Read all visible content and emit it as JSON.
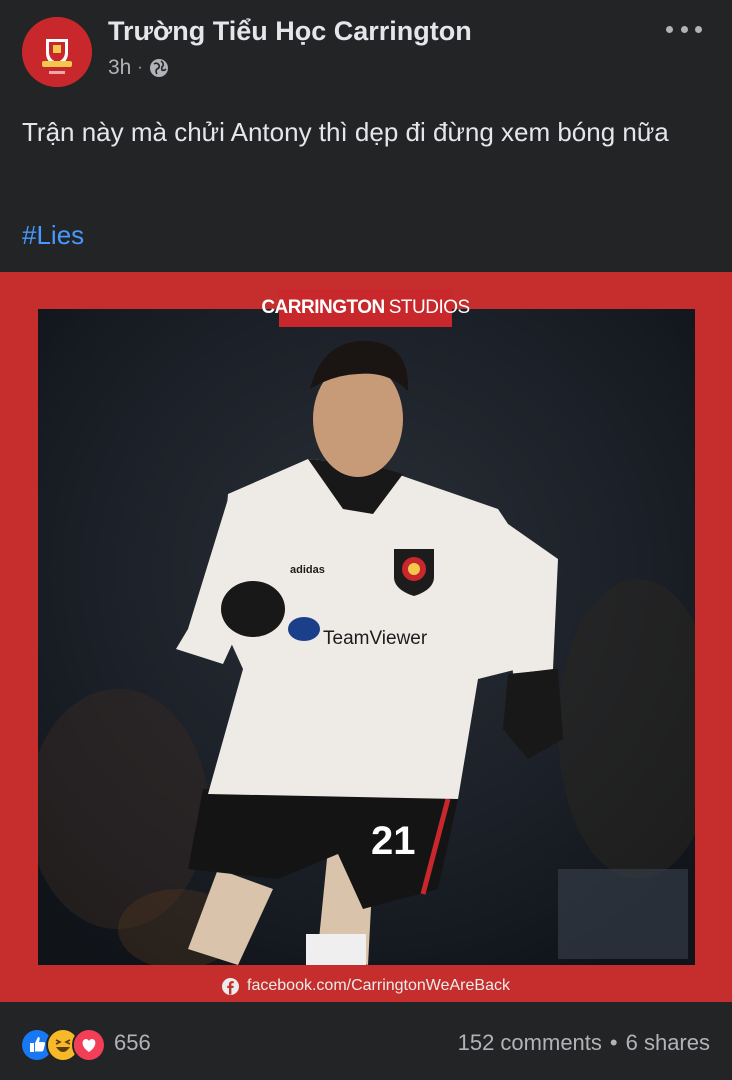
{
  "post": {
    "page_name": "Trường Tiểu Học Carrington",
    "time": "3h",
    "separator": "·",
    "text": "Trận này mà chửi Antony thì dẹp đi đừng xem bóng nữa",
    "hashtag": "#Lies"
  },
  "image": {
    "brand_part1": "CARRINGTON",
    "brand_part2": "STUDIOS",
    "credit": "facebook.com/CarringtonWeAreBack",
    "shirt_number": "21",
    "sponsor": "TeamViewer",
    "kit_brand": "adidas"
  },
  "footer": {
    "reaction_count": "656",
    "comments": "152 comments",
    "dot": "•",
    "shares": "6 shares"
  },
  "icons": {
    "avatar": "club-crest-icon",
    "privacy": "globe-icon",
    "menu": "more-icon",
    "credit": "facebook-icon",
    "reactions": [
      "like-icon",
      "haha-icon",
      "love-icon"
    ]
  },
  "colors": {
    "background": "#232425",
    "frame_red": "#c52e2c",
    "hashtag_blue": "#4599ff",
    "like_blue": "#1877f2",
    "love_red": "#f33e58",
    "haha_yellow": "#f7b928"
  }
}
